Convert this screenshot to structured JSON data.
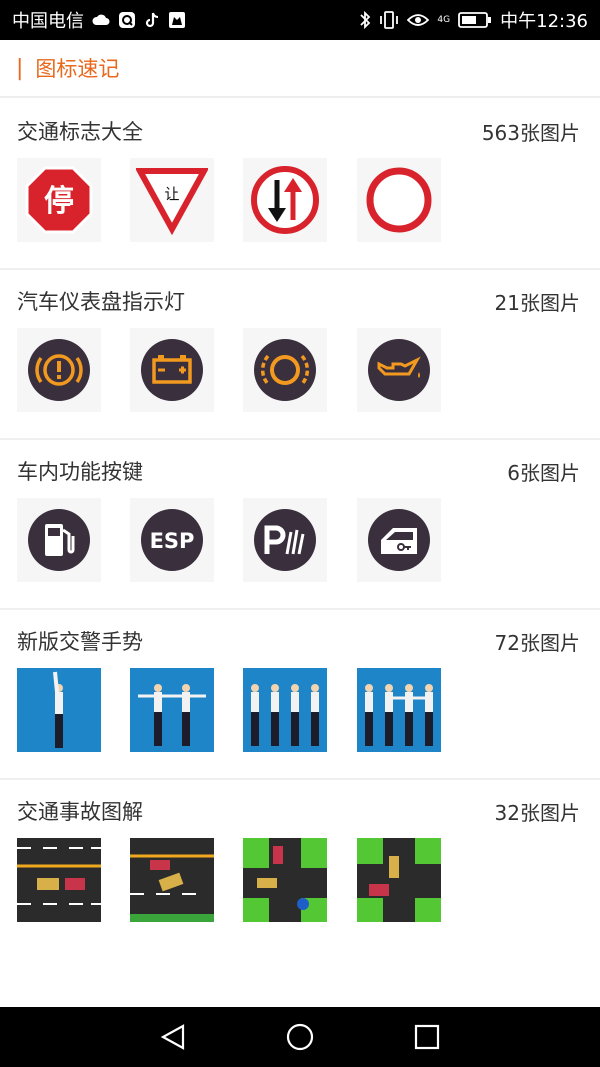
{
  "status_bar": {
    "carrier": "中国电信",
    "time": "中午12:36",
    "network": "4G"
  },
  "header": {
    "bar_char": "|",
    "title": "图标速记"
  },
  "sections": [
    {
      "title": "交通标志大全",
      "count": "563张图片",
      "icons": [
        "stop-sign-icon",
        "yield-sign-icon",
        "oncoming-priority-sign-icon",
        "no-vehicles-sign-icon"
      ]
    },
    {
      "title": "汽车仪表盘指示灯",
      "count": "21张图片",
      "icons": [
        "brake-warning-icon",
        "battery-warning-icon",
        "brake-pad-icon",
        "oil-pressure-icon"
      ]
    },
    {
      "title": "车内功能按键",
      "count": "6张图片",
      "icons": [
        "fuel-icon",
        "esp-icon",
        "parking-sensor-icon",
        "door-lock-icon"
      ]
    },
    {
      "title": "新版交警手势",
      "count": "72张图片",
      "icons": [
        "police-gesture-stop-icon",
        "police-gesture-straight-icon",
        "police-gesture-left-turn-icon",
        "police-gesture-right-turn-icon"
      ]
    },
    {
      "title": "交通事故图解",
      "count": "32张图片",
      "icons": [
        "accident-rear-end-icon",
        "accident-lane-change-icon",
        "accident-intersection-icon",
        "accident-crossroad-icon"
      ]
    }
  ],
  "sign_text": {
    "stop": "停",
    "yield": "让",
    "esp": "ESP"
  },
  "colors": {
    "accent": "#e8681c",
    "sign_red": "#d9232c",
    "dash_dark": "#3a2f3d",
    "dash_orange": "#f29a1f",
    "police_blue": "#1e86c8"
  }
}
